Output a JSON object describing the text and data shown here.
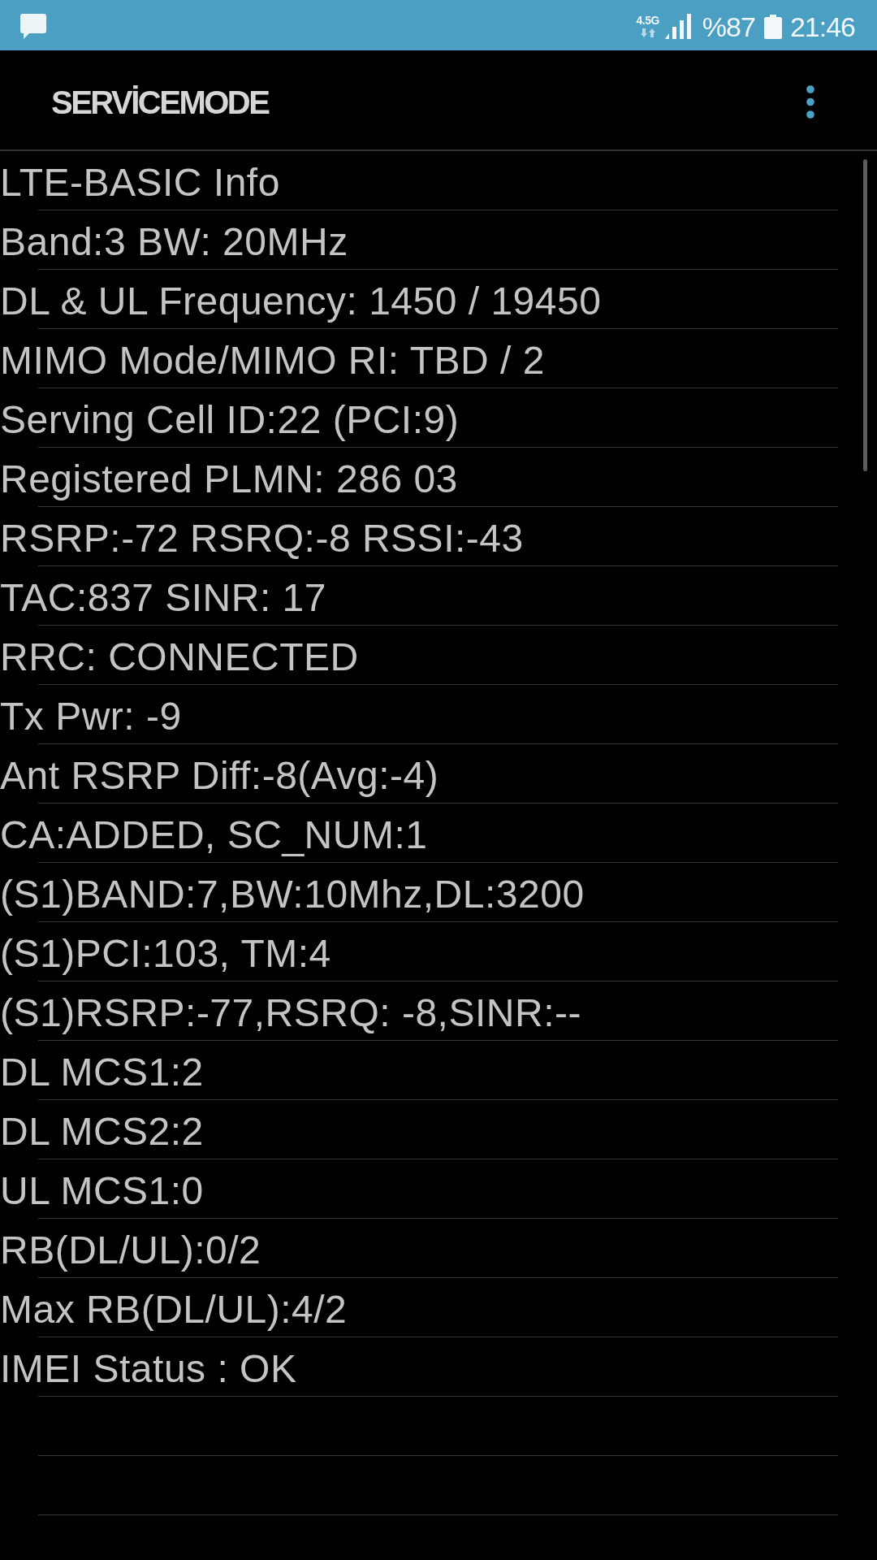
{
  "status_bar": {
    "network_type": "4.5G",
    "battery": "%87",
    "time": "21:46"
  },
  "app_bar": {
    "title": "SERVİCEMODE"
  },
  "info_lines": [
    "LTE-BASIC Info",
    "Band:3 BW: 20MHz",
    "DL & UL Frequency: 1450 / 19450",
    "MIMO Mode/MIMO RI: TBD / 2",
    "Serving Cell ID:22 (PCI:9)",
    "Registered PLMN: 286 03",
    "RSRP:-72 RSRQ:-8 RSSI:-43",
    "TAC:837 SINR: 17",
    "RRC: CONNECTED",
    "Tx Pwr: -9",
    "Ant RSRP Diff:-8(Avg:-4)",
    "CA:ADDED, SC_NUM:1",
    "(S1)BAND:7,BW:10Mhz,DL:3200",
    "(S1)PCI:103, TM:4",
    "(S1)RSRP:-77,RSRQ: -8,SINR:--",
    "DL MCS1:2",
    "DL MCS2:2",
    "UL MCS1:0",
    "RB(DL/UL):0/2",
    "Max RB(DL/UL):4/2",
    "IMEI Status : OK"
  ]
}
